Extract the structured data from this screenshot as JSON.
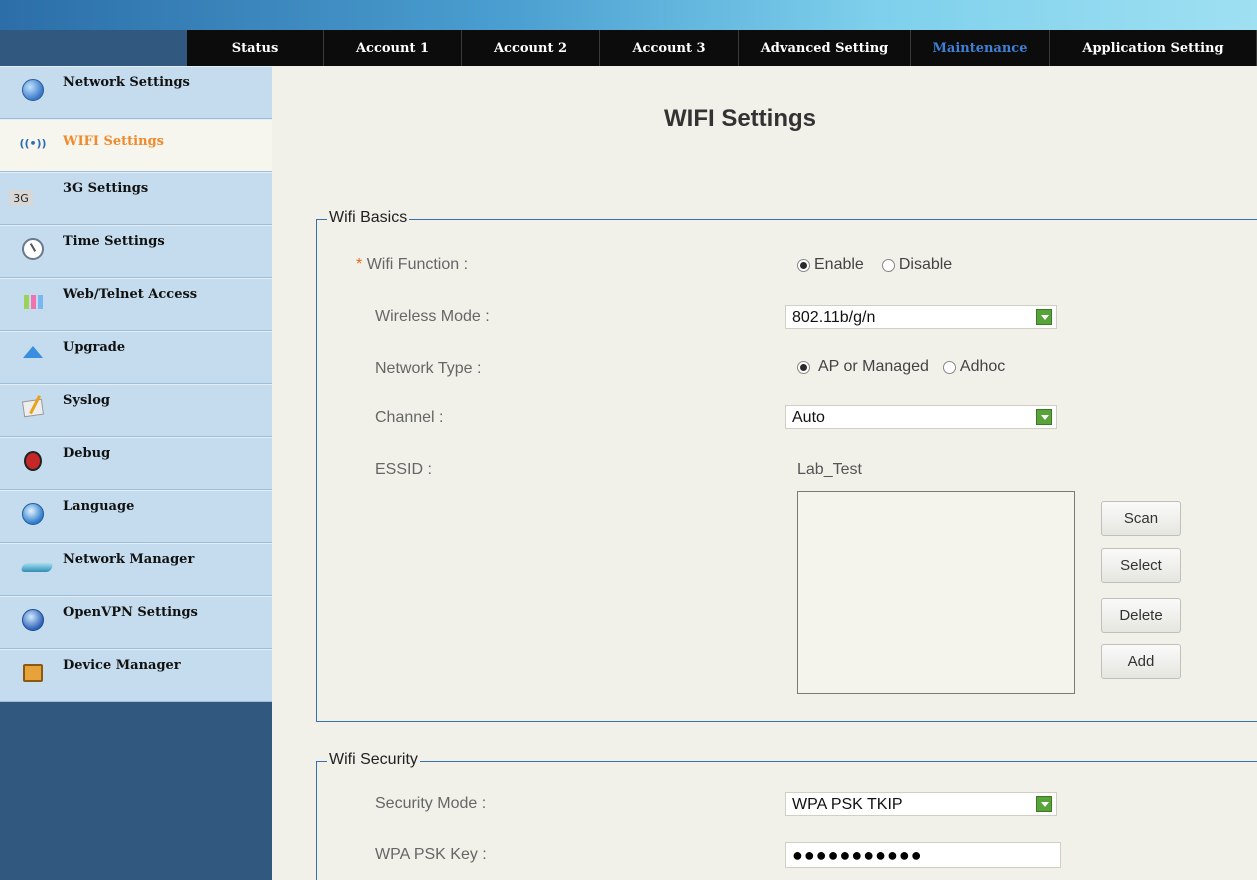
{
  "tabs": [
    {
      "label": "Status"
    },
    {
      "label": "Account 1"
    },
    {
      "label": "Account 2"
    },
    {
      "label": "Account 3"
    },
    {
      "label": "Advanced Setting"
    },
    {
      "label": "Maintenance",
      "active": true
    },
    {
      "label": "Application Setting"
    }
  ],
  "sidebar": {
    "items": [
      {
        "label": "Network Settings",
        "icon": "globe-gear-icon"
      },
      {
        "label": "WIFI Settings",
        "icon": "wifi-icon",
        "active": true
      },
      {
        "label": "3G Settings",
        "icon": "3g-icon",
        "icon_text": "3G"
      },
      {
        "label": "Time Settings",
        "icon": "clock-icon"
      },
      {
        "label": "Web/Telnet Access",
        "icon": "web-access-icon"
      },
      {
        "label": "Upgrade",
        "icon": "upgrade-arrow-icon"
      },
      {
        "label": "Syslog",
        "icon": "notepad-icon"
      },
      {
        "label": "Debug",
        "icon": "bug-icon"
      },
      {
        "label": "Language",
        "icon": "globe-icon"
      },
      {
        "label": "Network Manager",
        "icon": "network-device-icon"
      },
      {
        "label": "OpenVPN Settings",
        "icon": "vpn-globe-icon"
      },
      {
        "label": "Device Manager",
        "icon": "briefcase-icon"
      }
    ]
  },
  "page": {
    "title": "WIFI Settings"
  },
  "basics": {
    "legend": "Wifi Basics",
    "wifi_function": {
      "label": "Wifi Function :",
      "required_mark": "*",
      "enable": "Enable",
      "disable": "Disable",
      "value": "Enable"
    },
    "wireless_mode": {
      "label": "Wireless Mode :",
      "value": "802.11b/g/n"
    },
    "network_type": {
      "label": "Network Type :",
      "opt1": "AP or Managed",
      "opt2": "Adhoc",
      "value": "AP or Managed"
    },
    "channel": {
      "label": "Channel :",
      "value": "Auto"
    },
    "essid": {
      "label": "ESSID :",
      "value": "Lab_Test"
    },
    "buttons": {
      "scan": "Scan",
      "select": "Select",
      "delete": "Delete",
      "add": "Add"
    }
  },
  "security": {
    "legend": "Wifi Security",
    "mode": {
      "label": "Security Mode :",
      "value": "WPA PSK TKIP"
    },
    "key": {
      "label": "WPA PSK Key :",
      "value": "●●●●●●●●●●●"
    }
  },
  "colors": {
    "active_tab": "#3f7fd6",
    "active_menu": "#f08a2c",
    "sidebar_bg": "#c4dced",
    "fieldset_border": "#3b6fb4"
  }
}
